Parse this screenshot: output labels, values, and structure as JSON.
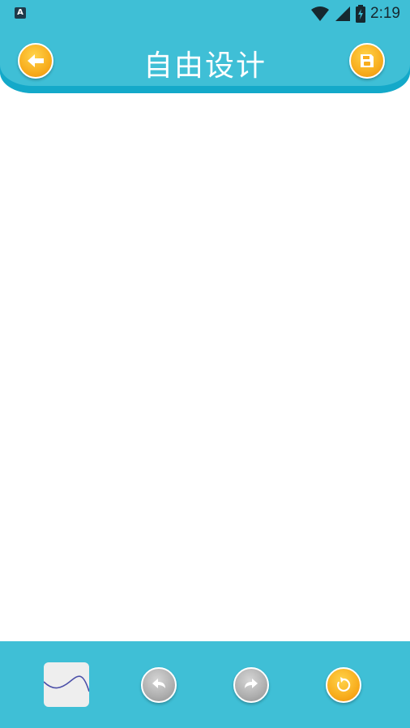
{
  "status_bar": {
    "app_icon_letter": "A",
    "time": "2:19"
  },
  "header": {
    "title": "自由设计",
    "back_icon": "arrow-left-icon",
    "save_icon": "floppy-disk-icon"
  },
  "toolbar": {
    "brush_icon": "wave-brush-icon",
    "undo_icon": "undo-arrow-icon",
    "redo_icon": "redo-arrow-icon",
    "reset_icon": "refresh-icon"
  },
  "colors": {
    "primary": "#3fbfd6",
    "header_edge": "#14a9c9",
    "accent_orange": "#f8ad1d",
    "disabled_gray": "#aeaeae",
    "brush_stroke": "#4b4fa8"
  }
}
